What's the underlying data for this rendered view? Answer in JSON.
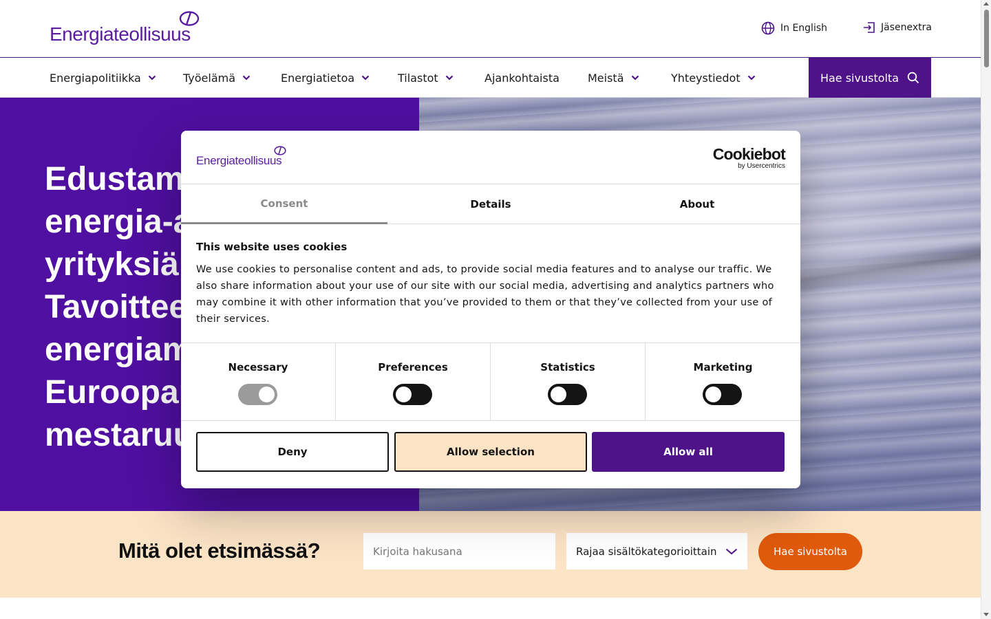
{
  "header": {
    "logo_text": "Energiateollisuus",
    "language_link": "In English",
    "member_link": "Jäsenextra"
  },
  "nav": {
    "items": [
      {
        "label": "Energiapolitiikka",
        "dropdown": true
      },
      {
        "label": "Työelämä",
        "dropdown": true
      },
      {
        "label": "Energiatietoa",
        "dropdown": true
      },
      {
        "label": "Tilastot",
        "dropdown": true
      },
      {
        "label": "Ajankohtaista",
        "dropdown": false
      },
      {
        "label": "Meistä",
        "dropdown": true
      },
      {
        "label": "Yhteystiedot",
        "dropdown": true
      }
    ],
    "search_label": "Hae sivustolta"
  },
  "hero": {
    "lines": [
      "Edustamme",
      "energia-alan",
      "yrityksiä.",
      "Tavoitteemme",
      "energiamurroksen",
      "Euroopan",
      "mestaruus"
    ]
  },
  "search_band": {
    "heading": "Mitä olet etsimässä?",
    "input_placeholder": "Kirjoita hakusana",
    "filter_label": "Rajaa sisältökategorioittain",
    "button_label": "Hae sivustolta"
  },
  "cookie": {
    "logo_text": "Energiateollisuus",
    "brand": "Cookiebot",
    "brand_sub": "by Usercentrics",
    "tabs": [
      "Consent",
      "Details",
      "About"
    ],
    "active_tab": "Consent",
    "title": "This website uses cookies",
    "text": "We use cookies to personalise content and ads, to provide social media features and to analyse our traffic. We also share information about your use of our site with our social media, advertising and analytics partners who may combine it with other information that you’ve provided to them or that they’ve collected from your use of their services.",
    "categories": [
      {
        "label": "Necessary",
        "checked": true,
        "disabled": true
      },
      {
        "label": "Preferences",
        "checked": false
      },
      {
        "label": "Statistics",
        "checked": false
      },
      {
        "label": "Marketing",
        "checked": false
      }
    ],
    "buttons": {
      "deny": "Deny",
      "allow_selection": "Allow selection",
      "allow_all": "Allow all"
    }
  },
  "colors": {
    "brand_purple": "#4f1389",
    "hero_purple": "#4f0fa0",
    "peach": "#fbe3c6",
    "orange": "#e05a0c"
  }
}
